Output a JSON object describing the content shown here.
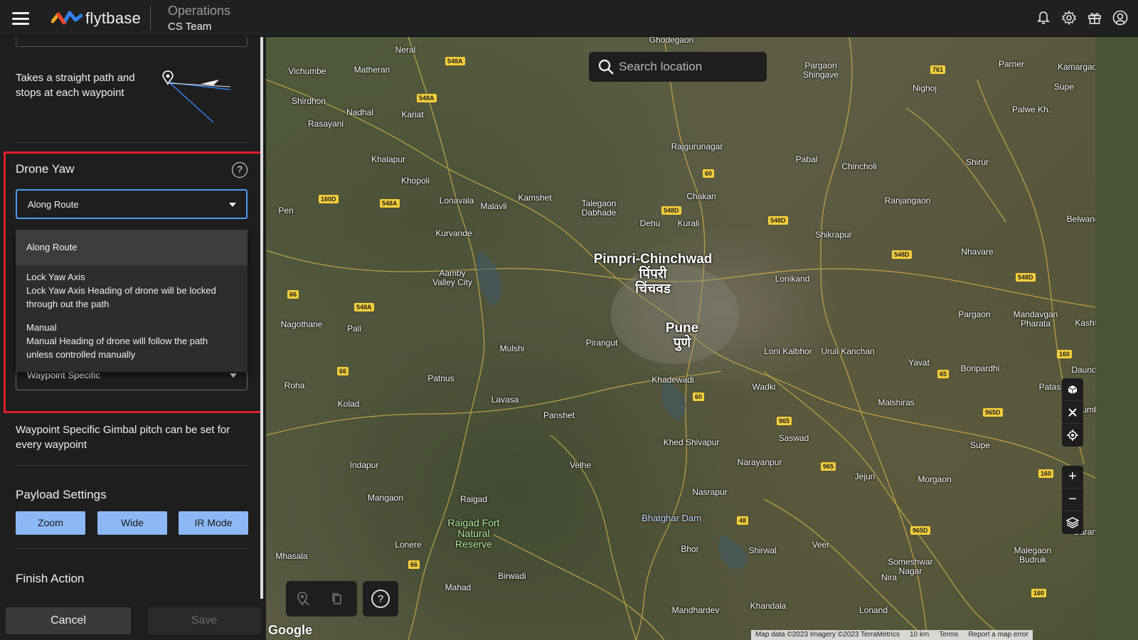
{
  "header": {
    "logo_text": "flytbase",
    "title": "Operations",
    "subtitle": "CS Team",
    "icons": [
      "menu-icon",
      "bell-icon",
      "gear-icon",
      "gift-icon",
      "account-icon"
    ]
  },
  "sidebar": {
    "route_description": "Takes a straight path and stops at each waypoint",
    "drone_yaw": {
      "label": "Drone Yaw",
      "selected": "Along Route",
      "options": [
        {
          "title": "Along Route",
          "desc": ""
        },
        {
          "title": "Lock Yaw Axis",
          "desc": "Lock Yaw Axis Heading of drone will be locked through out the path"
        },
        {
          "title": "Manual",
          "desc": "Manual Heading of drone will follow the path unless controlled manually"
        }
      ]
    },
    "gimbal": {
      "selected": "Waypoint Specific",
      "description": "Waypoint Specific Gimbal pitch can be set for every waypoint"
    },
    "payload": {
      "title": "Payload Settings",
      "buttons": [
        "Zoom",
        "Wide",
        "IR Mode"
      ]
    },
    "finish_action": {
      "title": "Finish Action"
    },
    "footer": {
      "cancel": "Cancel",
      "save": "Save"
    }
  },
  "map": {
    "search_placeholder": "Search location",
    "attribution": {
      "data": "Map data ©2023 Imagery ©2023 TerraMetrics",
      "scale": "10 km",
      "terms": "Terms",
      "report": "Report a map error"
    },
    "google": "Google",
    "major_labels": [
      {
        "name": "Pimpri-Chinchwad",
        "local": "पिंपरी चिंचवड"
      },
      {
        "name": "Pune",
        "local": "पुणे"
      }
    ],
    "labels": [
      "Ghodegaon",
      "Neral",
      "Matheran",
      "Vichumbe",
      "Shirdhon",
      "Rasayani",
      "Nadhal",
      "Kariat",
      "Khalapur",
      "Khopoli",
      "Lonavala",
      "Malavli",
      "Kamshet",
      "Talegaon Dabhade",
      "Rajgurunagar",
      "Chakan",
      "Dehu",
      "Kurali",
      "Pabal",
      "Chincholi",
      "Shirur",
      "Pargaon Shingave",
      "Parner",
      "Nighoj",
      "Palwe Kh.",
      "Kamargaon",
      "Supe",
      "Ranjangaon",
      "Shikrapur",
      "Nhavare",
      "Belwandi",
      "Kurvande",
      "Aamby Valley City",
      "Pen",
      "Nagothane",
      "Pali",
      "Mulshi",
      "Pirangut",
      "Lonikand",
      "Loni Kalbhor",
      "Uruli Kanchan",
      "Yavat",
      "Boripardhi",
      "Pargaon",
      "Mandavgan Pharata",
      "Kashti",
      "Daund",
      "Roha",
      "Kolad",
      "Patnus",
      "Lavasa",
      "Panshet",
      "Khadewadi",
      "Wadki",
      "Malshiras",
      "Patas",
      "Kurkumbh",
      "Saswad",
      "Khed Shivapur",
      "Supe",
      "Indapur",
      "Velhe",
      "Narayanpur",
      "Jejuri",
      "Morgaon",
      "Mangaon",
      "Raigad",
      "Raigad Fort Natural Reserve",
      "Bhatghar Dam",
      "Nasrapur",
      "Lonere",
      "Bhor",
      "Shirwal",
      "Veer",
      "Someshwar Nagar",
      "Malegaon Budruk",
      "Baramati",
      "Mhasala",
      "Birwadi",
      "Mahad",
      "Nira",
      "Khandala",
      "Mandhardev",
      "Lonand"
    ],
    "route_shields": [
      "548A",
      "761",
      "160D",
      "60",
      "548D",
      "66",
      "965",
      "965D",
      "160",
      "48",
      "65"
    ],
    "controls": [
      "cube-icon",
      "fullscreen-icon",
      "locate-icon",
      "zoom-in-icon",
      "zoom-out-icon",
      "layers-icon"
    ]
  },
  "colors": {
    "accent_blue": "#8eb8f5",
    "focus_blue": "#4a9df0",
    "highlight_red": "#e0202a",
    "panel_bg": "#1e1e1e"
  }
}
